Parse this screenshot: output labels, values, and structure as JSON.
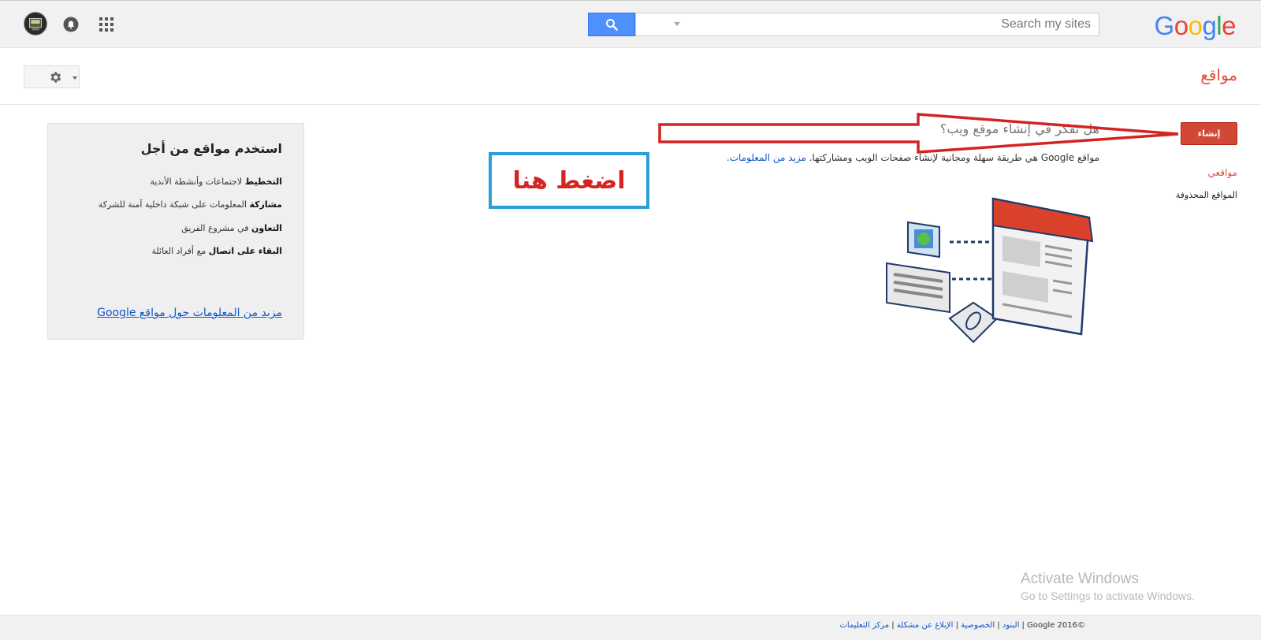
{
  "header": {
    "logo_letters": [
      {
        "ch": "G",
        "cls": "b"
      },
      {
        "ch": "o",
        "cls": "r"
      },
      {
        "ch": "o",
        "cls": "y"
      },
      {
        "ch": "g",
        "cls": "b"
      },
      {
        "ch": "l",
        "cls": "g"
      },
      {
        "ch": "e",
        "cls": "r"
      }
    ],
    "search": {
      "placeholder": "Search my sites",
      "value": ""
    },
    "icons": {
      "search": "search-icon",
      "notifications": "bell-icon",
      "apps": "apps-grid-icon",
      "account": "avatar"
    }
  },
  "subheader": {
    "title": "مواقع",
    "settings_icon": "gear-icon"
  },
  "sidebar": {
    "create_label": "إنشاء",
    "items": [
      {
        "label": "مواقعي"
      },
      {
        "label": "المواقع المحذوفة"
      }
    ]
  },
  "main": {
    "question": "هل تفكر في إنشاء موقع ويب؟",
    "description": "مواقع Google هي طريقة سهلة ومجانية لإنشاء صفحات الويب ومشاركتها.",
    "learn_more": "مزيد من المعلومات."
  },
  "annotation": {
    "text": "اضغط هنا",
    "colors": {
      "box": "#2a9fd6",
      "text": "#d42323",
      "arrow": "#d42323"
    }
  },
  "panel": {
    "title": "استخدم مواقع من أجل",
    "items": [
      {
        "bold": "التخطيط",
        "rest": " لاجتماعات وأنشطة الأندية"
      },
      {
        "bold": "مشاركة",
        "rest": " المعلومات على شبكة داخلية آمنة للشركة"
      },
      {
        "bold": "التعاون",
        "rest": " في مشروع الفريق"
      },
      {
        "bold": "البقاء على اتصال",
        "rest": " مع أفراد العائلة"
      }
    ],
    "more_link": "مزيد من المعلومات حول مواقع Google"
  },
  "watermark": {
    "line1": "Activate Windows",
    "line2": "Go to Settings to activate Windows."
  },
  "footer": {
    "copyright": "©Google 2016",
    "sep": " | ",
    "links": [
      "البنود",
      "الخصوصية",
      "الإبلاغ عن مشكلة",
      "مركز التعليمات"
    ]
  },
  "colors": {
    "accent_red": "#dd4b39",
    "create_red": "#d14836",
    "search_blue": "#4d90fe",
    "link_blue": "#1155cc"
  }
}
